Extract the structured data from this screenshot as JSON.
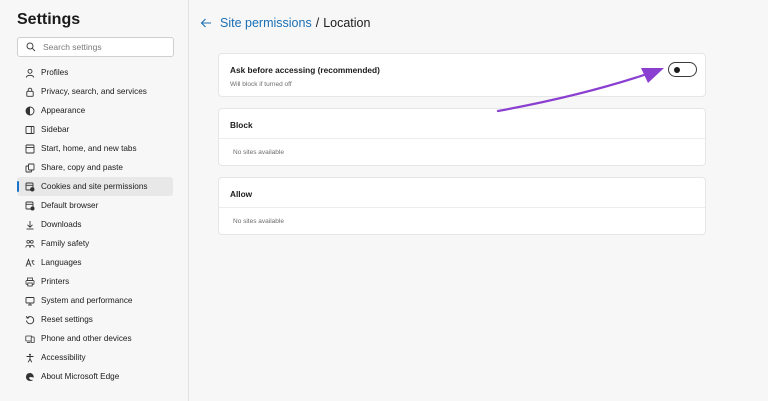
{
  "sidebar": {
    "title": "Settings",
    "search_placeholder": "Search settings",
    "items": [
      {
        "label": "Profiles",
        "icon": "profile-icon"
      },
      {
        "label": "Privacy, search, and services",
        "icon": "lock-icon"
      },
      {
        "label": "Appearance",
        "icon": "appearance-icon"
      },
      {
        "label": "Sidebar",
        "icon": "sidebar-icon"
      },
      {
        "label": "Start, home, and new tabs",
        "icon": "home-icon"
      },
      {
        "label": "Share, copy and paste",
        "icon": "share-icon"
      },
      {
        "label": "Cookies and site permissions",
        "icon": "cookies-icon",
        "active": true
      },
      {
        "label": "Default browser",
        "icon": "browser-icon"
      },
      {
        "label": "Downloads",
        "icon": "download-icon"
      },
      {
        "label": "Family safety",
        "icon": "family-icon"
      },
      {
        "label": "Languages",
        "icon": "languages-icon"
      },
      {
        "label": "Printers",
        "icon": "printer-icon"
      },
      {
        "label": "System and performance",
        "icon": "system-icon"
      },
      {
        "label": "Reset settings",
        "icon": "reset-icon"
      },
      {
        "label": "Phone and other devices",
        "icon": "phone-icon"
      },
      {
        "label": "Accessibility",
        "icon": "accessibility-icon"
      },
      {
        "label": "About Microsoft Edge",
        "icon": "edge-icon"
      }
    ]
  },
  "header": {
    "parent": "Site permissions",
    "separator": "/",
    "current": "Location"
  },
  "ask": {
    "title": "Ask before accessing (recommended)",
    "subtitle": "Will block if turned off",
    "toggle_on": false
  },
  "block": {
    "title": "Block",
    "empty": "No sites available"
  },
  "allow": {
    "title": "Allow",
    "empty": "No sites available"
  },
  "colors": {
    "accent": "#1a6fb5",
    "annotation_arrow": "#8a3fd1"
  }
}
